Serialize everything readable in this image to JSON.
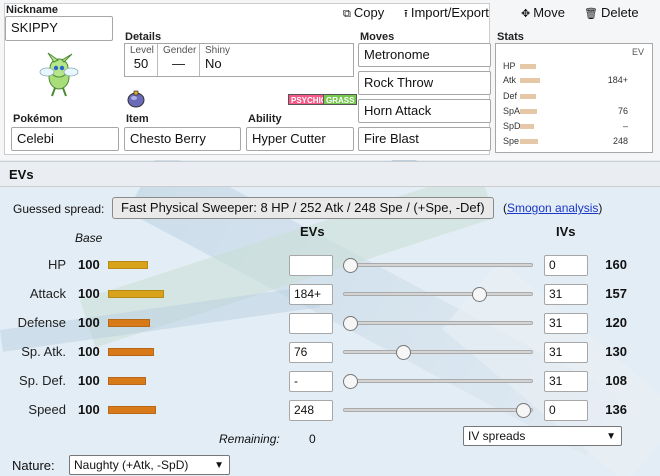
{
  "toolbar": {
    "copy": "Copy",
    "import_export": "Import/Export",
    "move": "Move",
    "delete": "Delete"
  },
  "set": {
    "nickname_label": "Nickname",
    "nickname": "SKIPPY",
    "details_label": "Details",
    "level_label": "Level",
    "level": "50",
    "gender_label": "Gender",
    "gender": "—",
    "shiny_label": "Shiny",
    "shiny": "No",
    "types": [
      {
        "name": "PSYCHIC",
        "color": "#f85888"
      },
      {
        "name": "GRASS",
        "color": "#78c850"
      }
    ],
    "pokemon_label": "Pokémon",
    "pokemon": "Celebi",
    "item_label": "Item",
    "item": "Chesto Berry",
    "ability_label": "Ability",
    "ability": "Hyper Cutter",
    "moves_label": "Moves",
    "moves": [
      "Metronome",
      "Rock Throw",
      "Horn Attack",
      "Fire Blast"
    ],
    "stats_label": "Stats",
    "ev_col_label": "EV",
    "stats": [
      {
        "name": "HP",
        "ev": ""
      },
      {
        "name": "Atk",
        "ev": "184+"
      },
      {
        "name": "Def",
        "ev": ""
      },
      {
        "name": "SpA",
        "ev": "76"
      },
      {
        "name": "SpD",
        "ev": "–"
      },
      {
        "name": "Spe",
        "ev": "248"
      }
    ]
  },
  "evs": {
    "header": "EVs",
    "guessed_label": "Guessed spread:",
    "guessed_spread": "Fast Physical Sweeper: 8 HP / 252 Atk / 248 Spe / (+Spe, -Def)",
    "paren_open": "(",
    "smogon_link": "Smogon analysis",
    "paren_close": ")",
    "base_header": "Base",
    "evs_header": "EVs",
    "ivs_header": "IVs",
    "rows": [
      {
        "label": "HP",
        "base": "100",
        "ev": "",
        "ev_slider_value": 0,
        "iv": "0",
        "total": "160"
      },
      {
        "label": "Attack",
        "base": "100",
        "ev": "184+",
        "ev_slider_value": 184,
        "iv": "31",
        "total": "157"
      },
      {
        "label": "Defense",
        "base": "100",
        "ev": "",
        "ev_slider_value": 0,
        "iv": "31",
        "total": "120"
      },
      {
        "label": "Sp. Atk.",
        "base": "100",
        "ev": "76",
        "ev_slider_value": 76,
        "iv": "31",
        "total": "130"
      },
      {
        "label": "Sp. Def.",
        "base": "100",
        "ev": "-",
        "ev_slider_value": 0,
        "iv": "31",
        "total": "108"
      },
      {
        "label": "Speed",
        "base": "100",
        "ev": "248",
        "ev_slider_value": 248,
        "iv": "0",
        "total": "136"
      }
    ],
    "remaining_label": "Remaining:",
    "remaining": "0",
    "iv_spreads": "IV spreads",
    "nature_label": "Nature:",
    "nature": "Naughty (+Atk, -SpD)"
  },
  "colors": {
    "base_bar_hp": "#d8a31a",
    "base_bar_attack": "#d8a31a",
    "base_bar_other": "#d87a1a",
    "link": "#1a37c8"
  }
}
